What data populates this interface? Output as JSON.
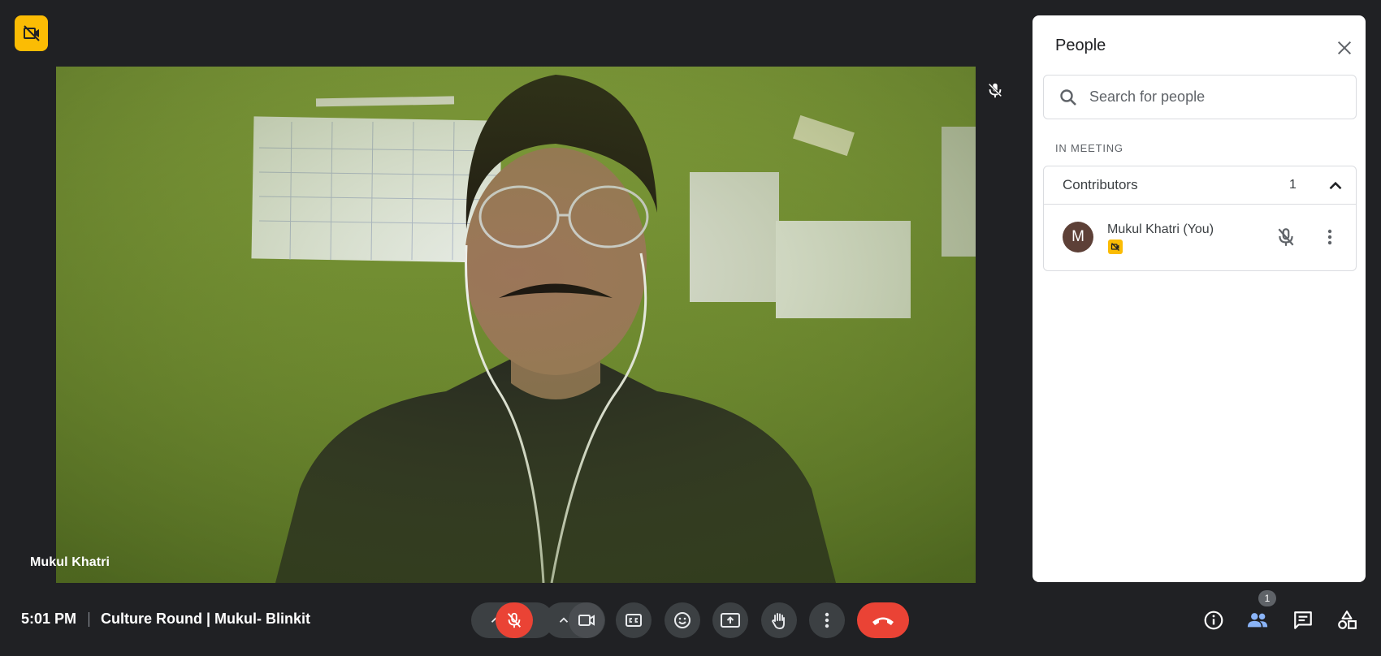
{
  "participant": {
    "name": "Mukul Khatri"
  },
  "panel": {
    "title": "People",
    "search_placeholder": "Search for people",
    "section_label": "IN MEETING",
    "group": {
      "label": "Contributors",
      "count": "1"
    },
    "person": {
      "initial": "M",
      "name": "Mukul Khatri (You)"
    }
  },
  "bottom_bar": {
    "time": "5:01 PM",
    "meeting_title": "Culture Round | Mukul- Blinkit",
    "people_count": "1"
  },
  "colors": {
    "background": "#202124",
    "accent_yellow": "#fbbc04",
    "end_call_red": "#ea4335",
    "active_blue": "#8ab4f8"
  },
  "icons": [
    "video-off-icon",
    "mic-off-icon",
    "close-icon",
    "search-icon",
    "chevron-up-icon",
    "more-vert-icon",
    "camera-icon",
    "captions-icon",
    "emoji-icon",
    "present-icon",
    "hand-icon",
    "hangup-icon",
    "info-icon",
    "people-icon",
    "chat-icon",
    "activities-icon"
  ]
}
